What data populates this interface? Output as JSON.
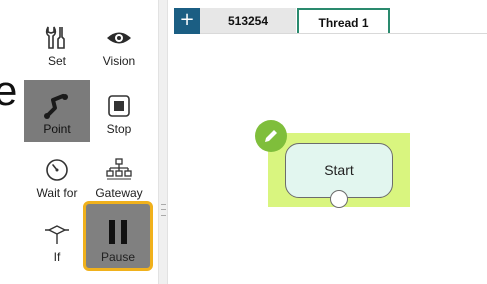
{
  "palette": {
    "tools": [
      {
        "label": "Set",
        "icon": "set-icon"
      },
      {
        "label": "Vision",
        "icon": "eye-icon"
      },
      {
        "label": "Point",
        "icon": "point-icon"
      },
      {
        "label": "Stop",
        "icon": "stop-icon"
      },
      {
        "label": "Wait for",
        "icon": "timer-icon"
      },
      {
        "label": "Gateway",
        "icon": "gateway-icon"
      },
      {
        "label": "If",
        "icon": "branch-icon"
      },
      {
        "label": "Pause",
        "icon": "pause-icon"
      }
    ]
  },
  "partial_text": "e",
  "tabs": {
    "add_label": "+",
    "items": [
      {
        "label": "513254"
      },
      {
        "label": "Thread 1"
      }
    ]
  },
  "canvas": {
    "start_node_label": "Start"
  },
  "colors": {
    "tab_add_bg": "#1b5e83",
    "active_tab_border": "#2a8a6e",
    "node_highlight": "#d9f57f",
    "node_fill": "#e2f6ef",
    "edit_badge": "#7fbe3b",
    "pause_highlight_border": "#f0b11c"
  }
}
